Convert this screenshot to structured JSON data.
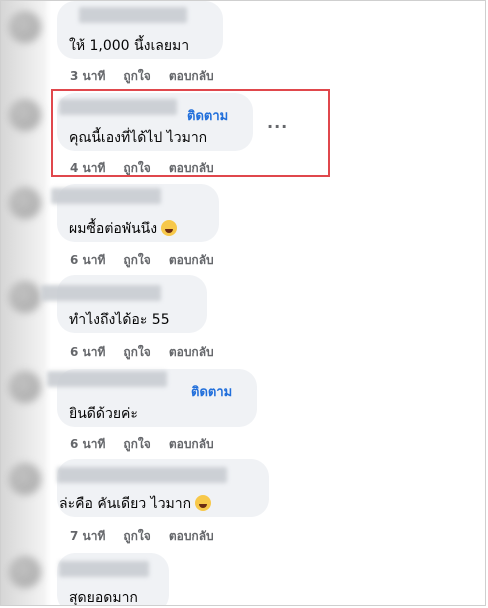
{
  "comments": [
    {
      "text": "ให้ 1,000 นึ้งเลยมา",
      "time": "3 นาที",
      "like": "ถูกใจ",
      "reply": "ตอบกลับ",
      "follow": "",
      "emoji": ""
    },
    {
      "text": "คุณนี้เองที่ได้ไป ไวมาก",
      "time": "4 นาที",
      "like": "ถูกใจ",
      "reply": "ตอบกลับ",
      "follow": "ติดตาม",
      "emoji": ""
    },
    {
      "text": "ผมซื้อต่อพันนึง",
      "time": "6 นาที",
      "like": "ถูกใจ",
      "reply": "ตอบกลับ",
      "follow": "",
      "emoji": "grinning-squint-emoji"
    },
    {
      "text": "ทำไงถึงได้อะ 55",
      "time": "6 นาที",
      "like": "ถูกใจ",
      "reply": "ตอบกลับ",
      "follow": "",
      "emoji": ""
    },
    {
      "text": "ยินดีด้วยค่ะ",
      "time": "6 นาที",
      "like": "ถูกใจ",
      "reply": "ตอบกลับ",
      "follow": "ติดตาม",
      "emoji": ""
    },
    {
      "text": "ล่ะคือ คันเดียว ไวมาก",
      "time": "7 นาที",
      "like": "ถูกใจ",
      "reply": "ตอบกลับ",
      "follow": "",
      "emoji": "laughing-emoji"
    },
    {
      "text": "สุดยอดมาก",
      "time": "",
      "like": "",
      "reply": "",
      "follow": "",
      "emoji": ""
    }
  ],
  "more_menu": "...",
  "colors": {
    "highlight": "#e0474c",
    "link": "#216fdb",
    "bubble": "#f0f2f5",
    "meta": "#65676b"
  }
}
